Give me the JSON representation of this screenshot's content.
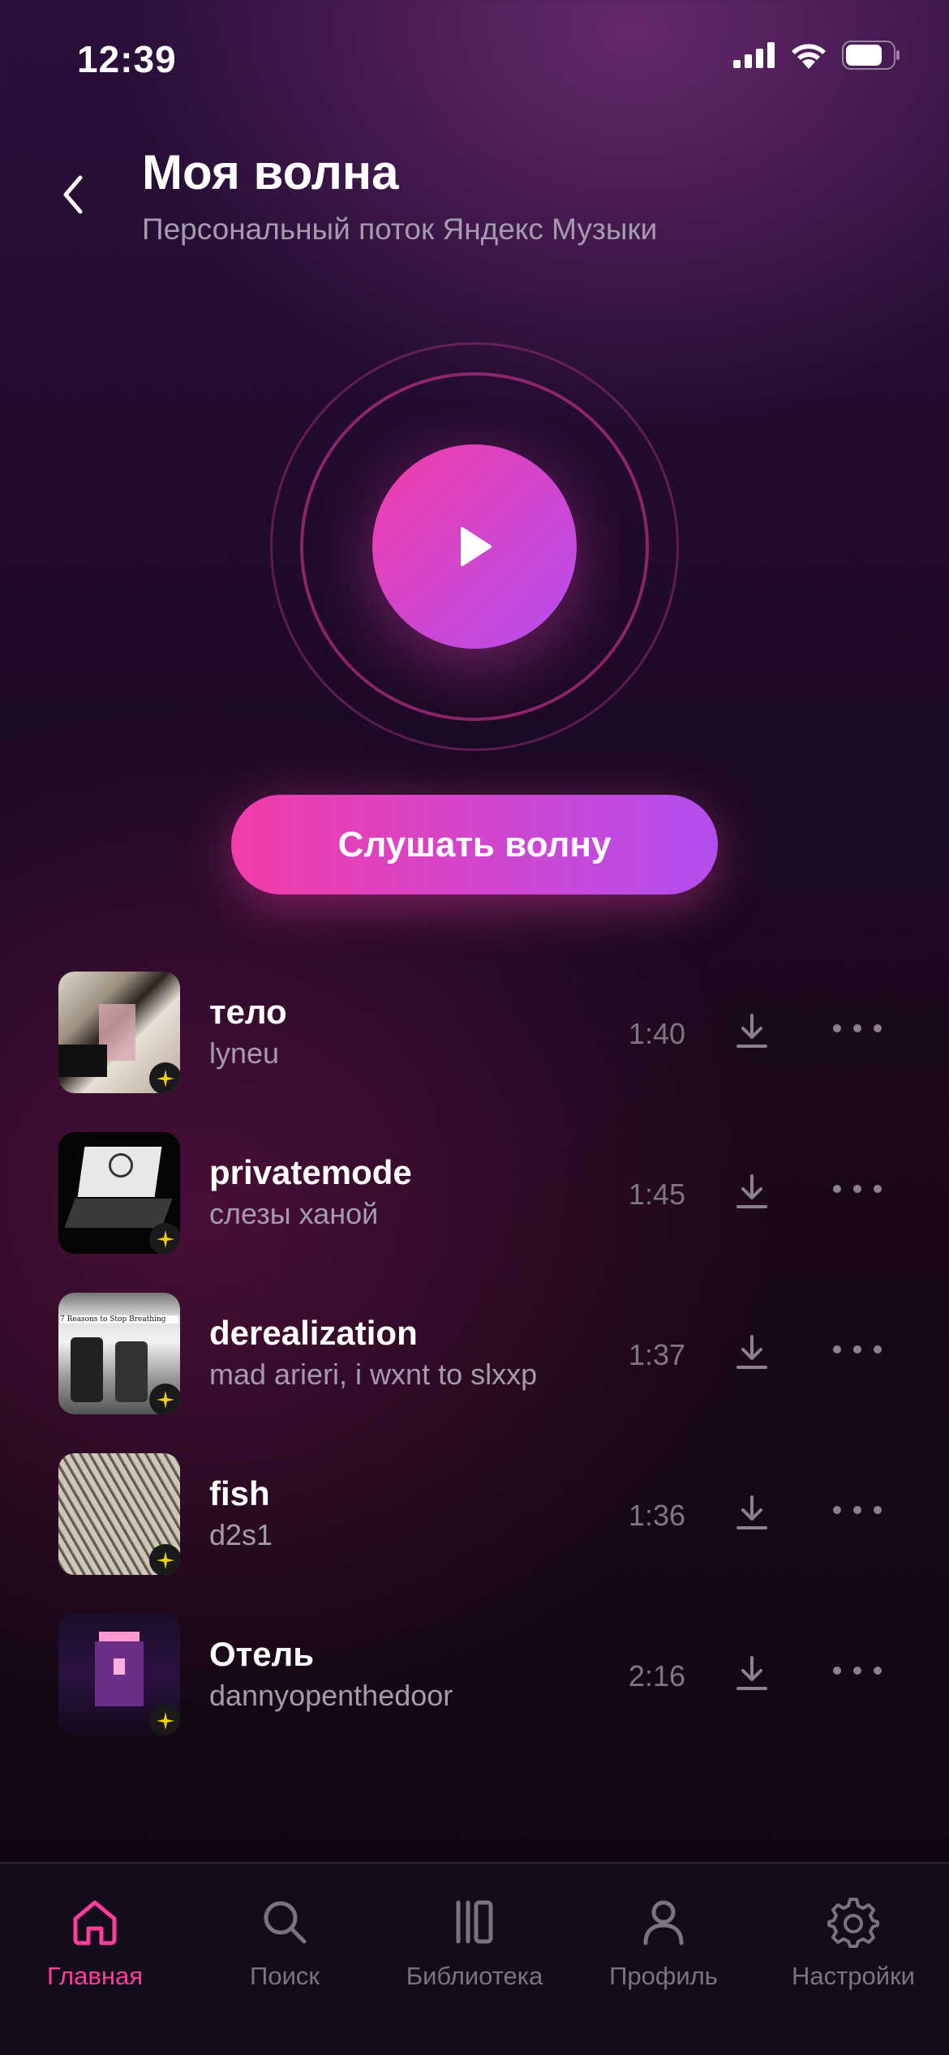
{
  "status_bar": {
    "time": "12:39"
  },
  "header": {
    "title": "Моя волна",
    "subtitle": "Персональный поток Яндекс Музыки"
  },
  "wave": {
    "listen_label": "Слушать волну"
  },
  "tracks": [
    {
      "title": "тело",
      "artist": "lyneu",
      "duration": "1:40"
    },
    {
      "title": "privatemode",
      "artist": "слезы ханой",
      "duration": "1:45"
    },
    {
      "title": "derealization",
      "artist": "mad arieri, i wxnt to slxxp",
      "duration": "1:37",
      "cover_text": "7 Reasons to Stop Breathing"
    },
    {
      "title": "fish",
      "artist": "d2s1",
      "duration": "1:36"
    },
    {
      "title": "Отель",
      "artist": "dannyopenthedoor",
      "duration": "2:16"
    }
  ],
  "tabbar": {
    "items": [
      {
        "label": "Главная",
        "icon": "home-icon",
        "active": true
      },
      {
        "label": "Поиск",
        "icon": "search-icon",
        "active": false
      },
      {
        "label": "Библиотека",
        "icon": "library-icon",
        "active": false
      },
      {
        "label": "Профиль",
        "icon": "profile-icon",
        "active": false
      },
      {
        "label": "Настройки",
        "icon": "settings-icon",
        "active": false
      }
    ],
    "active_color": "#ff3d9a",
    "inactive_color": "#7b7382"
  },
  "colors": {
    "accent_start": "#f23da8",
    "accent_end": "#b44ef0"
  }
}
